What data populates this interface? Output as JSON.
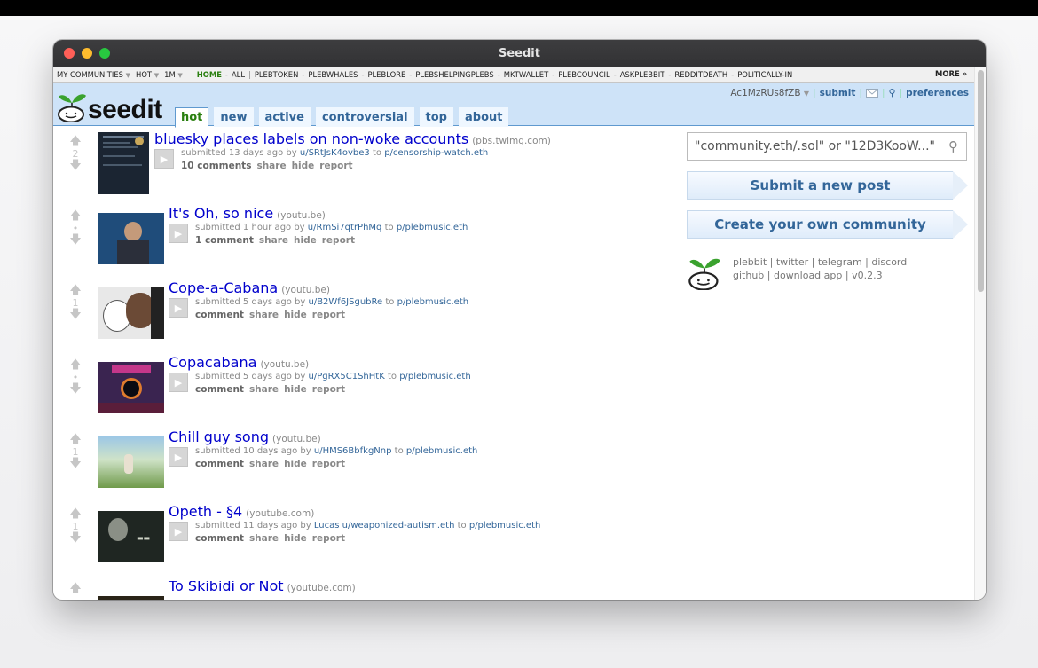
{
  "window": {
    "title": "Seedit"
  },
  "subreddit_bar": {
    "my_communities": "MY COMMUNITIES",
    "sort": "HOT",
    "time": "1M",
    "home": "HOME",
    "all": "ALL",
    "communities": [
      "PLEBTOKEN",
      "PLEBWHALES",
      "PLEBLORE",
      "PLEBSHELPINGPLEBS",
      "MKTWALLET",
      "PLEBCOUNCIL",
      "ASKPLEBBIT",
      "REDDITDEATH",
      "POLITICALLY-IN"
    ],
    "more": "MORE »"
  },
  "header": {
    "logo_text": "seedit",
    "tabs": [
      "hot",
      "new",
      "active",
      "controversial",
      "top",
      "about"
    ],
    "selected_tab": "hot",
    "user": "Ac1MzRUs8fZB",
    "submit": "submit",
    "preferences": "preferences"
  },
  "posts": [
    {
      "score": "2",
      "title": "bluesky places labels on non-woke accounts",
      "domain": "(pbs.twimg.com)",
      "submitted": "submitted 13 days ago by",
      "author": "u/SRtJsK4ovbe3",
      "to": "to",
      "community": "p/censorship-watch.eth",
      "comments": "10 comments"
    },
    {
      "score": "•",
      "title": "It's Oh, so nice",
      "domain": "(youtu.be)",
      "submitted": "submitted 1 hour ago by",
      "author": "u/RmSi7qtrPhMq",
      "to": "to",
      "community": "p/plebmusic.eth",
      "comments": "1 comment"
    },
    {
      "score": "1",
      "title": "Cope-a-Cabana",
      "domain": "(youtu.be)",
      "submitted": "submitted 5 days ago by",
      "author": "u/B2Wf6JSgubRe",
      "to": "to",
      "community": "p/plebmusic.eth",
      "comments": "comment"
    },
    {
      "score": "•",
      "title": "Copacabana",
      "domain": "(youtu.be)",
      "submitted": "submitted 5 days ago by",
      "author": "u/PgRX5C1ShHtK",
      "to": "to",
      "community": "p/plebmusic.eth",
      "comments": "comment"
    },
    {
      "score": "1",
      "title": "Chill guy song",
      "domain": "(youtu.be)",
      "submitted": "submitted 10 days ago by",
      "author": "u/HMS6BbfkgNnp",
      "to": "to",
      "community": "p/plebmusic.eth",
      "comments": "comment"
    },
    {
      "score": "1",
      "title": "Opeth - §4",
      "domain": "(youtube.com)",
      "submitted": "submitted 11 days ago by",
      "author": "Lucas u/weaponized-autism.eth",
      "to": "to",
      "community": "p/plebmusic.eth",
      "comments": "comment"
    },
    {
      "score": "",
      "title": "To Skibidi or Not",
      "domain": "(youtube.com)",
      "submitted": "",
      "author": "",
      "to": "",
      "community": "",
      "comments": ""
    }
  ],
  "post_actions": {
    "share": "share",
    "hide": "hide",
    "report": "report"
  },
  "sidebar": {
    "search_placeholder": "\"community.eth/.sol\" or \"12D3KooW...\"",
    "submit_post": "Submit a new post",
    "create_community": "Create your own community",
    "footer_line1": "plebbit | twitter | telegram | discord",
    "footer_line2": "github | download app | v0.2.3"
  },
  "colors": {
    "link": "#0000cc",
    "header_bg": "#cee3f8",
    "accent_green": "#2a7f10",
    "nav_blue": "#336699"
  }
}
